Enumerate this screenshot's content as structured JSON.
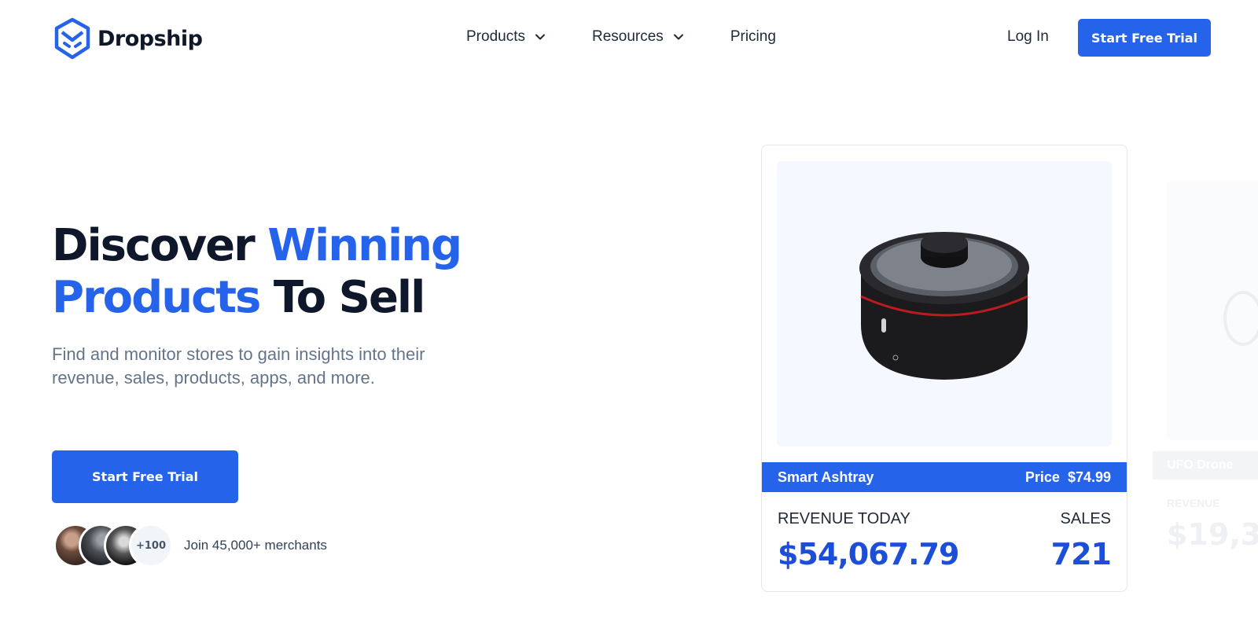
{
  "brand": {
    "name": "Dropship"
  },
  "nav": {
    "items": [
      {
        "label": "Products",
        "has_dropdown": true
      },
      {
        "label": "Resources",
        "has_dropdown": true
      },
      {
        "label": "Pricing",
        "has_dropdown": false
      }
    ],
    "login_label": "Log In",
    "cta_label": "Start Free Trial"
  },
  "hero": {
    "headline_part1": "Discover ",
    "headline_accent1": "Winning",
    "headline_accent2": "Products",
    "headline_part2": " To Sell",
    "subtitle": "Find and monitor stores to gain insights into their revenue, sales, products, apps, and more.",
    "cta_label": "Start Free Trial",
    "social_more": "+100",
    "social_text": "Join 45,000+ merchants"
  },
  "product_card": {
    "name": "Smart Ashtray",
    "price_label": "Price",
    "price": "$74.99",
    "revenue_label": "REVENUE TODAY",
    "revenue_value": "$54,067.79",
    "sales_label": "SALES",
    "sales_value": "721"
  },
  "ghost_card": {
    "name": "UFO Drone",
    "revenue_label": "REVENUE",
    "revenue_value": "$19,3"
  },
  "colors": {
    "accent": "#2563eb",
    "heading": "#0f172a",
    "muted": "#64748b"
  },
  "icons": [
    "logo-mark-icon",
    "chevron-down-icon"
  ]
}
